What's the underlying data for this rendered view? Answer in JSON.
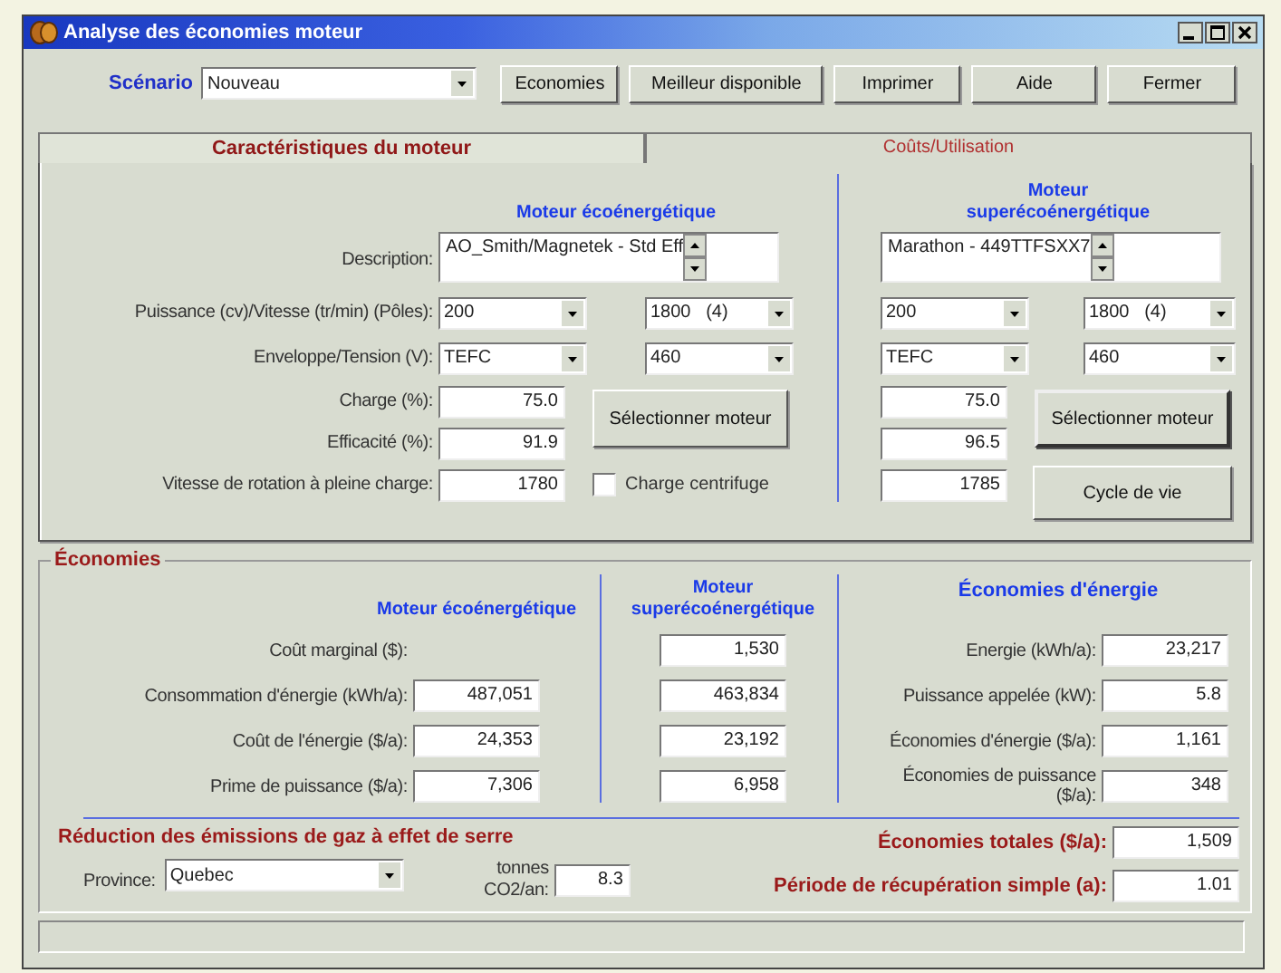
{
  "window": {
    "title": "Analyse des économies moteur"
  },
  "toolbar": {
    "scenario_label": "Scénario",
    "scenario": "Nouveau",
    "buttons": [
      "Economies",
      "Meilleur disponible",
      "Imprimer",
      "Aide",
      "Fermer"
    ]
  },
  "tabs": [
    {
      "label": "Caractéristiques du moteur",
      "selected": true
    },
    {
      "label": "Coûts/Utilisation",
      "selected": false
    }
  ],
  "motor_panel": {
    "labels": [
      "Description:",
      "Puissance (cv)/Vitesse (tr/min) (Pôles):",
      "Enveloppe/Tension (V):",
      "Charge (%):",
      "Efficacité (%):",
      "Vitesse de rotation à pleine charge:"
    ],
    "motors": [
      {
        "heading": "Moteur écoénergétique",
        "description": "AO_Smith/Magnetek - Std Eff",
        "power": "200",
        "speed": "1800   (4)",
        "enclosure": "TEFC",
        "voltage": "460",
        "charge": "75.0",
        "efficiency": "91.9",
        "full_load_speed": "1780",
        "select_button": "Sélectionner moteur"
      },
      {
        "heading": "Moteur superécoénergétique",
        "description": "Marathon - 449TTFSXX7",
        "power": "200",
        "speed": "1800   (4)",
        "enclosure": "TEFC",
        "voltage": "460",
        "charge": "75.0",
        "efficiency": "96.5",
        "full_load_speed": "1785",
        "select_button": "Sélectionner moteur"
      }
    ],
    "centrifugal": {
      "label": "Charge centrifuge",
      "checked": false
    },
    "life_cycle_button": "Cycle de vie"
  },
  "savings": {
    "title": "Économies",
    "headings": [
      "Moteur écoénergétique",
      "Moteur superécoénergétique",
      "Économies d'énergie"
    ],
    "rows": [
      {
        "label": "Coût marginal ($):",
        "value_2": "1,530"
      },
      {
        "label": "Consommation d'énergie (kWh/a):",
        "value_1": "487,051",
        "value_2": "463,834"
      },
      {
        "label": "Coût de l'énergie ($/a):",
        "value_1": "24,353",
        "value_2": "23,192"
      },
      {
        "label": "Prime de puissance ($/a):",
        "value_1": "7,306",
        "value_2": "6,958"
      }
    ],
    "energy_rows": [
      {
        "label": "Energie (kWh/a):",
        "value": "23,217"
      },
      {
        "label": "Puissance appelée (kW):",
        "value": "5.8"
      },
      {
        "label": "Économies d'énergie ($/a):",
        "value": "1,161"
      },
      {
        "label": "Économies de puissance ($/a):",
        "value": "348"
      }
    ],
    "ghg": {
      "title": "Réduction des émissions de gaz à effet de serre",
      "province_label": "Province:",
      "province": "Quebec",
      "tonnes_label": "tonnes CO2/an:",
      "tonnes": "8.3"
    },
    "totals": [
      {
        "label": "Économies totales ($/a):",
        "value": "1,509"
      },
      {
        "label": "Période de récupération simple (a):",
        "value": "1.01"
      }
    ]
  }
}
